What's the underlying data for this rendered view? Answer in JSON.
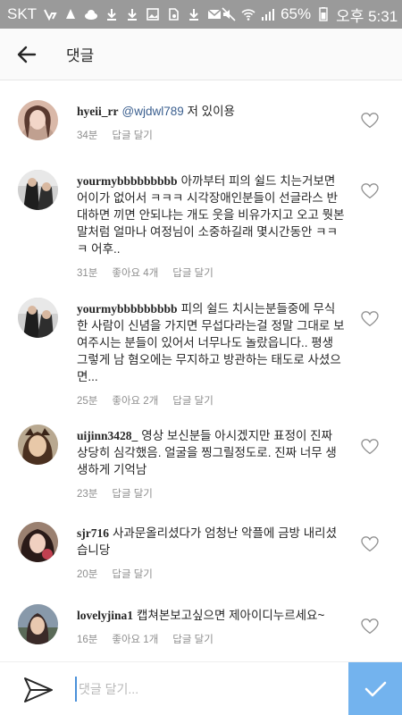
{
  "status_bar": {
    "carrier": "SKT",
    "battery": "65%",
    "time": "오후 5:31",
    "left_icons": [
      "volte-icon",
      "chat-icon",
      "cloud-icon",
      "download-icon",
      "download-icon",
      "image-icon",
      "sd-card-icon",
      "download-icon",
      "mail-icon"
    ],
    "right_icons": [
      "mute-icon",
      "wifi-icon",
      "signal-icon",
      "battery-icon"
    ]
  },
  "header": {
    "back_icon": "arrow-left-icon",
    "title": "댓글"
  },
  "comments": [
    {
      "username": "hyeii_rr",
      "mention": "@wjdwl789",
      "text": " 저 있이용",
      "time": "34분",
      "likes": "",
      "reply": "답글 달기",
      "avatar_color": "#6b4a3e"
    },
    {
      "username": "yourmybbbbbbbbb",
      "mention": "",
      "text": "아까부터 피의 쉴드 치는거보면 어이가 없어서 ㅋㅋㅋ 시각장애인분들이 선글라스 반대하면 끼면 안되냐는 개도 웃을 비유가지고 오고 뭣본말처럼 얼마나 여정님이 소중하길래 몇시간동안 ㅋㅋㅋ 어후..",
      "time": "31분",
      "likes": "좋아요 4개",
      "reply": "답글 달기",
      "avatar_color": "#2a2a2a"
    },
    {
      "username": "yourmybbbbbbbbb",
      "mention": "",
      "text": "피의 쉴드 치시는분들중에 무식한 사람이 신념을 가지면 무섭다라는걸 정말 그대로 보여주시는 분들이 있어서 너무나도 놀랐읍니다.. 평생 그렇게 남 혐오에는 무지하고 방관하는 태도로 사셨으면...",
      "time": "25분",
      "likes": "좋아요 2개",
      "reply": "답글 달기",
      "avatar_color": "#2a2a2a"
    },
    {
      "username": "uijinn3428_",
      "mention": "",
      "text": "영상 보신분들 아시겠지만 표정이 진짜 상당히 심각했음. 얼굴을 찡그릴정도로. 진짜 너무 생생하게 기억남",
      "time": "23분",
      "likes": "",
      "reply": "답글 달기",
      "avatar_color": "#8a6a4a"
    },
    {
      "username": "sjr716",
      "mention": "",
      "text": "사과문올리셨다가 엄청난 악플에 금방 내리셨습니당",
      "time": "20분",
      "likes": "",
      "reply": "답글 달기",
      "avatar_color": "#7a3a4a"
    },
    {
      "username": "lovelyjina1",
      "mention": "",
      "text": "캡쳐본보고싶으면 제아이디누르세요~",
      "time": "16분",
      "likes": "좋아요 1개",
      "reply": "답글 달기",
      "avatar_color": "#5a6a7a"
    }
  ],
  "composer": {
    "placeholder": "댓글 달기...",
    "value": "",
    "share_icon": "send-arrow-icon",
    "submit_icon": "check-icon",
    "submit_color": "#73b3ee"
  }
}
